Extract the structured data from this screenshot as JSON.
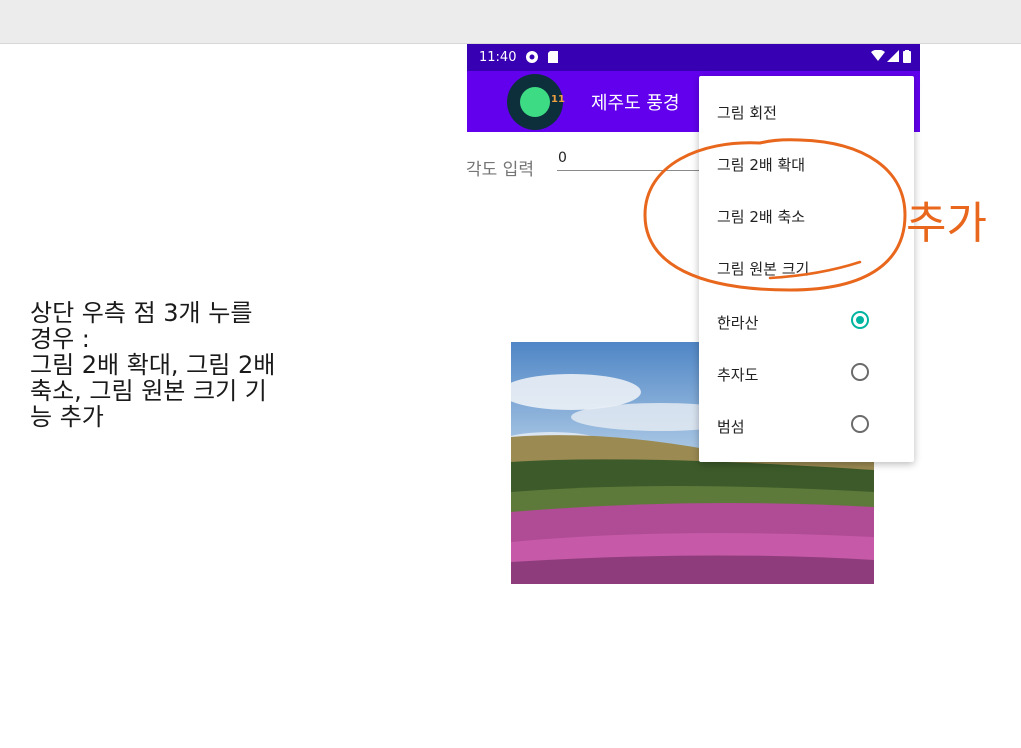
{
  "note": {
    "lines": [
      "상단 우측 점 3개 누를",
      "경우 :",
      "그림 2배 확대, 그림 2배",
      "축소, 그림 원본 크기 기",
      "능 추가"
    ]
  },
  "status_bar": {
    "time": "11:40"
  },
  "app_bar": {
    "title": "제주도 풍경",
    "logo_badge": "11"
  },
  "angle": {
    "label": "각도 입력",
    "value": "0"
  },
  "menu": {
    "items": [
      {
        "label": "그림 회전",
        "type": "action"
      },
      {
        "label": "그림 2배 확대",
        "type": "action"
      },
      {
        "label": "그림 2배 축소",
        "type": "action"
      },
      {
        "label": "그림 원본 크기",
        "type": "action"
      },
      {
        "label": "한라산",
        "type": "radio",
        "checked": true
      },
      {
        "label": "추자도",
        "type": "radio",
        "checked": false
      },
      {
        "label": "범섬",
        "type": "radio",
        "checked": false
      }
    ]
  },
  "annotation": {
    "text": "추가",
    "color": "#e8671c"
  },
  "colors": {
    "primary": "#6200ee",
    "primary_dark": "#3700b3",
    "accent": "#03b4a0"
  }
}
